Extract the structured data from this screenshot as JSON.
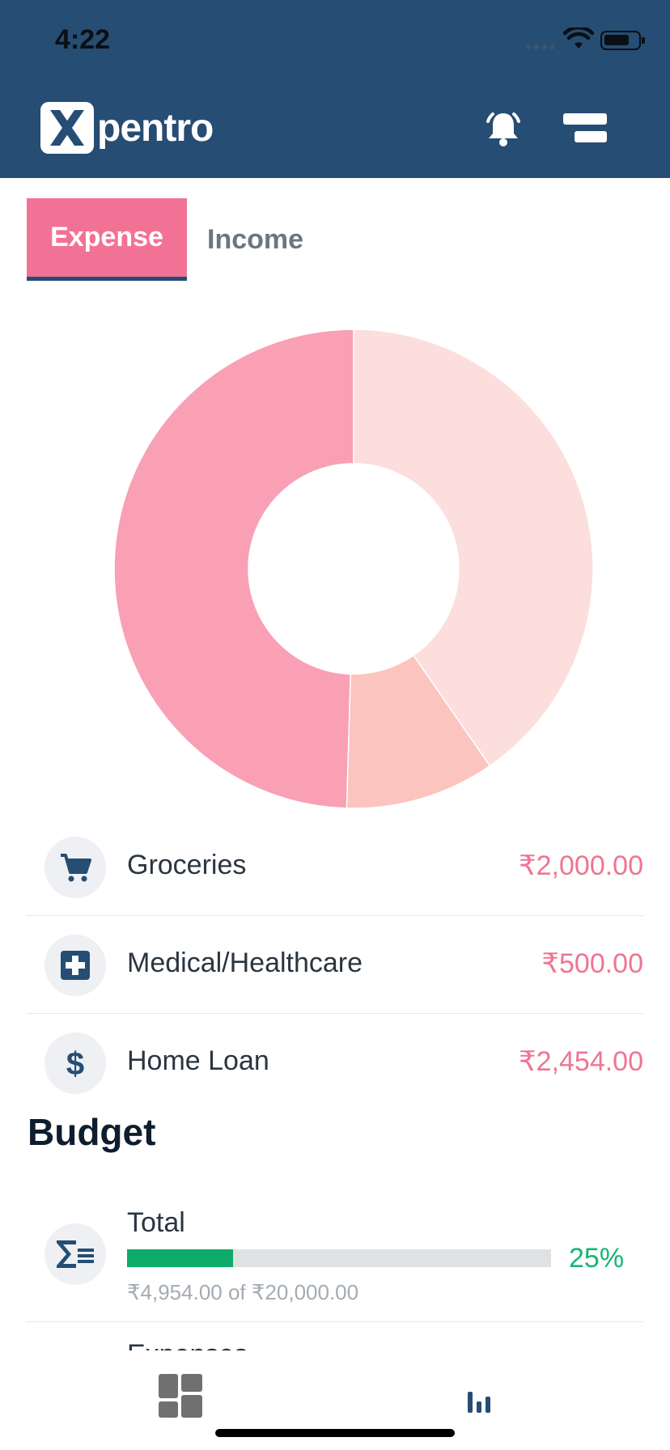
{
  "status_bar": {
    "time": "4:22"
  },
  "header": {
    "logo_text": "pentro",
    "colors": {
      "background": "#264d73"
    },
    "icons": [
      "bell-icon",
      "menu-icon"
    ]
  },
  "tabs": [
    {
      "label": "Expense",
      "active": true
    },
    {
      "label": "Income",
      "active": false
    }
  ],
  "chart_data": {
    "type": "pie",
    "style": "donut",
    "categories": [
      "Groceries",
      "Medical/Healthcare",
      "Home Loan"
    ],
    "values": [
      2000.0,
      500.0,
      2454.0
    ],
    "colors": [
      "#fcdedd",
      "#fbc4bf",
      "#f9a0b5"
    ]
  },
  "categories": [
    {
      "label": "Groceries",
      "amount": "₹2,000.00",
      "icon": "cart-icon"
    },
    {
      "label": "Medical/Healthcare",
      "amount": "₹500.00",
      "icon": "medical-icon"
    },
    {
      "label": "Home Loan",
      "amount": "₹2,454.00",
      "icon": "dollar-icon"
    }
  ],
  "budget": {
    "title": "Budget",
    "items": [
      {
        "label": "Total",
        "percent": "25%",
        "progress": 0.25,
        "detail": "₹4,954.00 of ₹20,000.00",
        "icon": "sigma-list-icon"
      }
    ],
    "next_item_partial": "Expenses"
  },
  "bottom_nav": {
    "items": [
      {
        "icon": "dashboard-icon"
      },
      {
        "icon": "bar-chart-icon"
      }
    ]
  }
}
